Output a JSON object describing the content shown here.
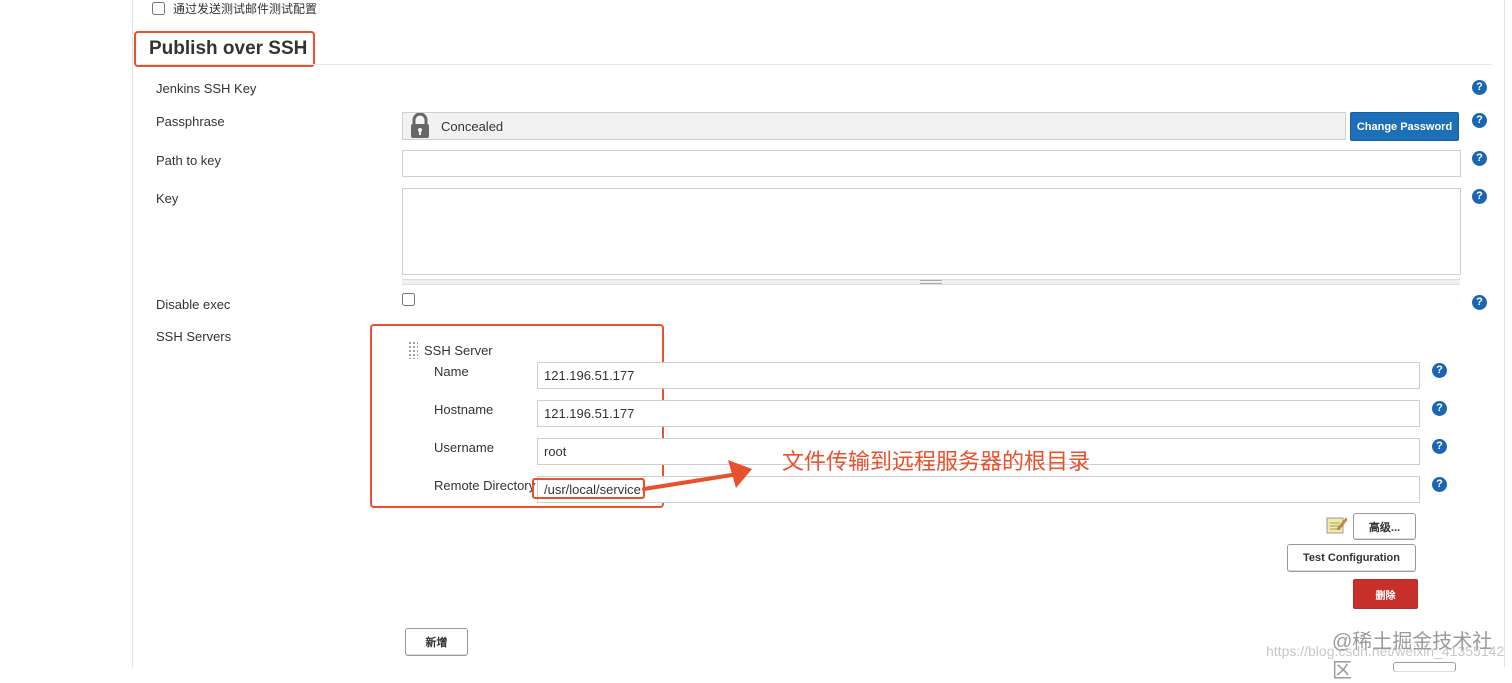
{
  "top_option": {
    "label": "通过发送测试邮件测试配置"
  },
  "section": {
    "title": "Publish over SSH"
  },
  "fields": {
    "jenkins_ssh_key": {
      "label": "Jenkins SSH Key"
    },
    "passphrase": {
      "label": "Passphrase",
      "value": "Concealed",
      "button": "Change Password"
    },
    "path_to_key": {
      "label": "Path to key",
      "value": ""
    },
    "key": {
      "label": "Key",
      "value": ""
    },
    "disable_exec": {
      "label": "Disable exec"
    },
    "ssh_servers": {
      "label": "SSH Servers"
    }
  },
  "ssh_server": {
    "title": "SSH Server",
    "name": {
      "label": "Name",
      "value": "121.196.51.177"
    },
    "hostname": {
      "label": "Hostname",
      "value": "121.196.51.177"
    },
    "username": {
      "label": "Username",
      "value": "root"
    },
    "remote_directory": {
      "label": "Remote Directory",
      "value": "/usr/local/service"
    },
    "advanced_button": "高级...",
    "test_button": "Test Configuration",
    "delete_button": "删除"
  },
  "add_button": "新增",
  "help_glyph": "?",
  "annotation": "文件传输到远程服务器的根目录",
  "watermark": {
    "url": "https://blog.csdn.net/weixin_41355142",
    "brand": "@稀土掘金技术社区"
  },
  "colors": {
    "accent_red": "#e8512b",
    "help_blue": "#1a66b3",
    "button_blue": "#1d6fb8",
    "delete_red": "#c9302c"
  }
}
